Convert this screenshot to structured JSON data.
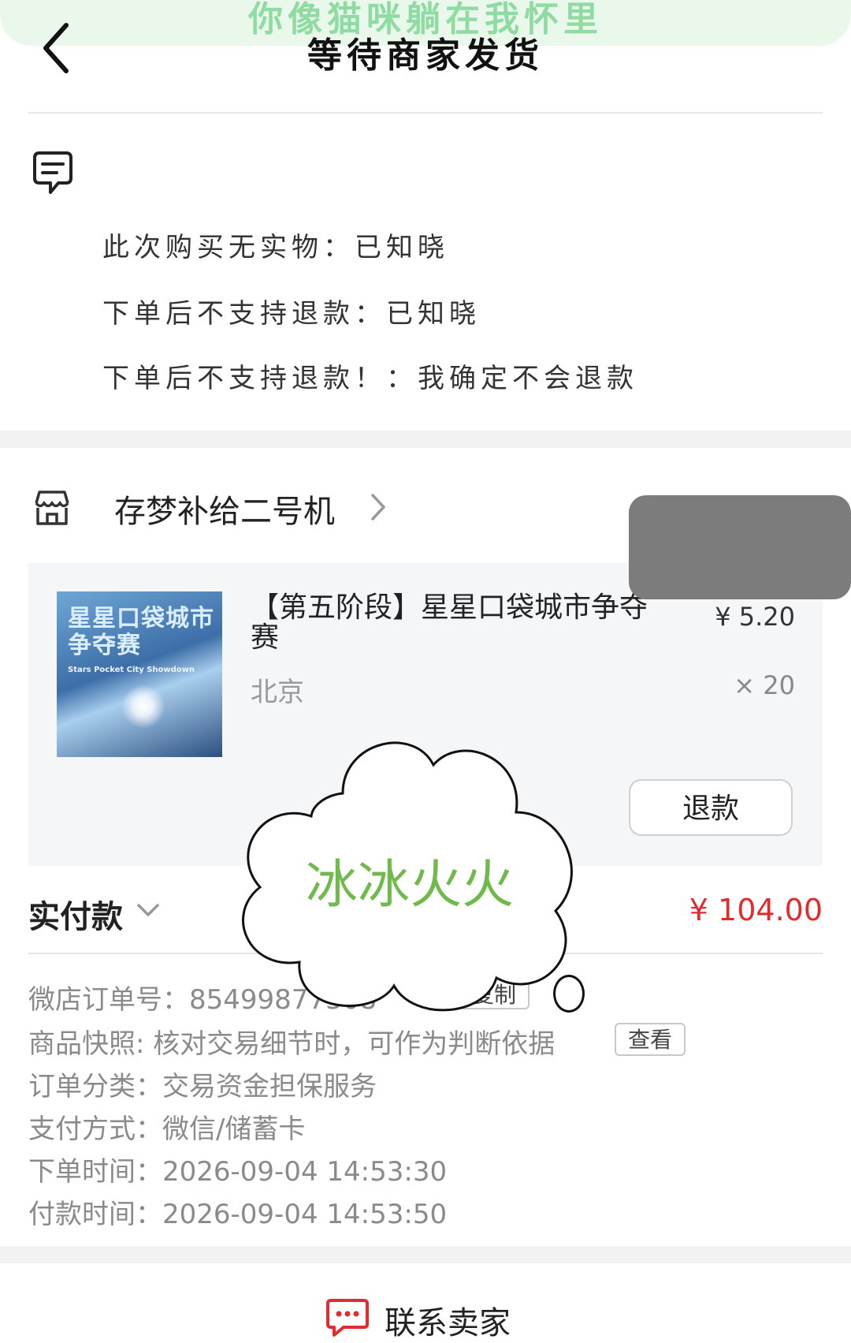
{
  "banner": {
    "text": "你像猫咪躺在我怀里"
  },
  "header": {
    "title": "等待商家发货",
    "back_icon": "chevron-left-icon"
  },
  "notes": {
    "icon": "note-icon",
    "lines": [
      "此次购买无实物：已知晓",
      "下单后不支持退款：已知晓",
      "下单后不支持退款！：我确定不会退款"
    ]
  },
  "shop": {
    "name": "存梦补给二号机",
    "icon": "shop-icon"
  },
  "product": {
    "title": "【第五阶段】星星口袋城市争夺赛",
    "variant": "北京",
    "price": "¥ 5.20",
    "quantity": "× 20",
    "thumbnail": {
      "title": "星星口袋城市争夺赛",
      "subtitle": "Stars Pocket City Showdown"
    },
    "refund_label": "退款"
  },
  "payment": {
    "label": "实付款",
    "amount": "¥ 104.00"
  },
  "order_info": {
    "order_no": "微店订单号：85499877308",
    "copy_label": "复制",
    "snapshot": "商品快照: 核对交易细节时，可作为判断依据",
    "view_label": "查看",
    "category": "订单分类：交易资金担保服务",
    "pay_method": "支付方式：微信/储蓄卡",
    "order_time": "下单时间：2026-09-04 14:53:30",
    "pay_time": "付款时间：2026-09-04 14:53:50"
  },
  "overlay": {
    "cloud_text": "冰冰火火"
  },
  "contact": {
    "label": "联系卖家",
    "icon": "chat-icon"
  },
  "colors": {
    "price_red": "#e02c2c",
    "cloud_green": "#6fba4a",
    "banner_green": "#8fdca3"
  }
}
